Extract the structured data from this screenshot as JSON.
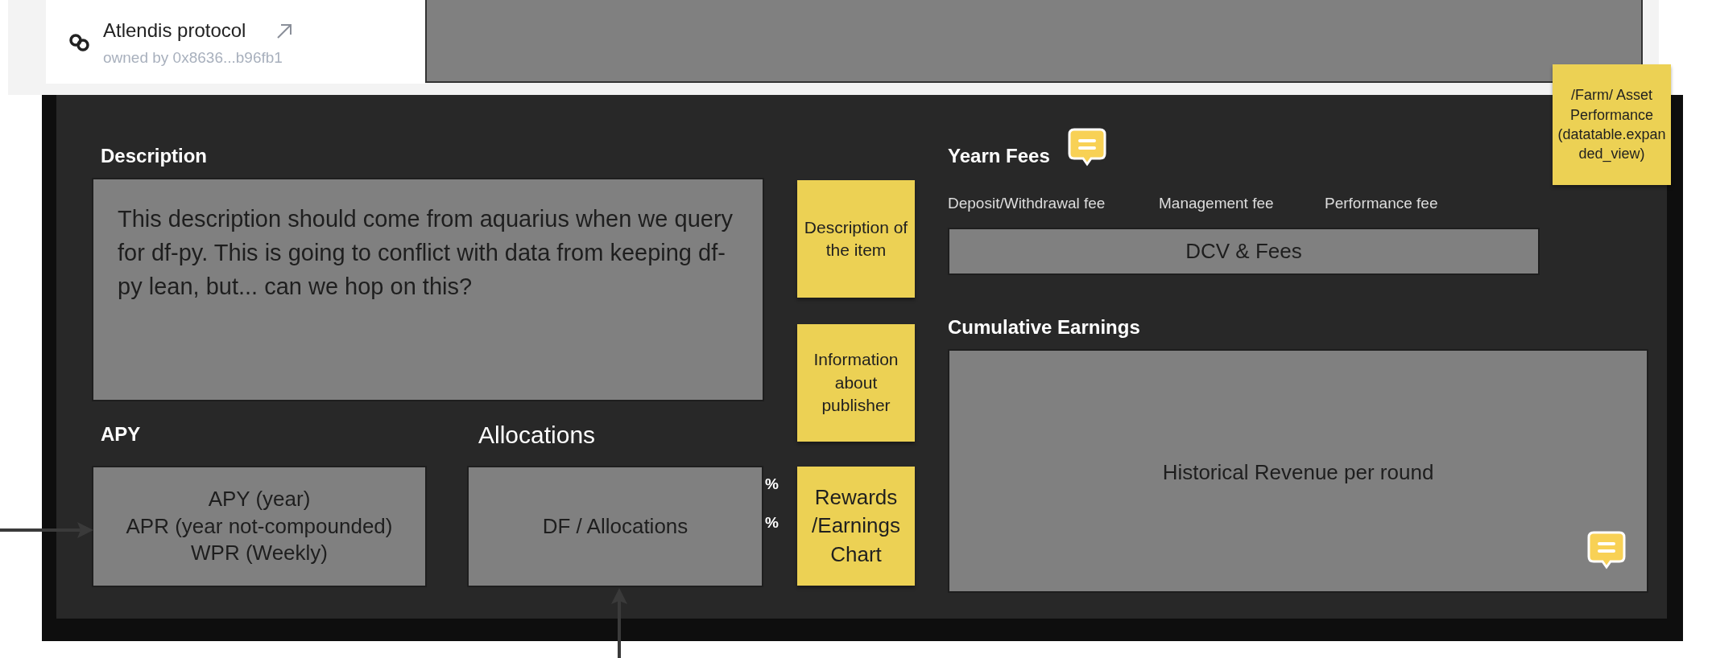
{
  "header": {
    "title": "Atlendis protocol",
    "owner": "owned by 0x8636...b96fb1"
  },
  "description": {
    "heading": "Description",
    "text": "This description should come from aquarius when we query for df-py. This is going to conflict with data from keeping df-py lean, but... can we hop on this?"
  },
  "notes": [
    {
      "text": "Description of the item"
    },
    {
      "text": "Information about publisher"
    },
    {
      "text": "Rewards /Earnings Chart"
    },
    {
      "text": "/Farm/ Asset Performance (datatable.expanded_view)"
    }
  ],
  "apy": {
    "heading": "APY",
    "lines": [
      "APY (year)",
      "APR (year not-compounded)",
      "WPR (Weekly)"
    ]
  },
  "allocations": {
    "heading": "Allocations",
    "box_text": "DF / Allocations",
    "marks": [
      "%",
      "%"
    ]
  },
  "fees": {
    "heading": "Yearn Fees",
    "labels": [
      "Deposit/Withdrawal fee",
      "Management fee",
      "Performance fee"
    ],
    "box_text": "DCV & Fees"
  },
  "earnings": {
    "heading": "Cumulative Earnings",
    "box_text": "Historical Revenue per round"
  }
}
